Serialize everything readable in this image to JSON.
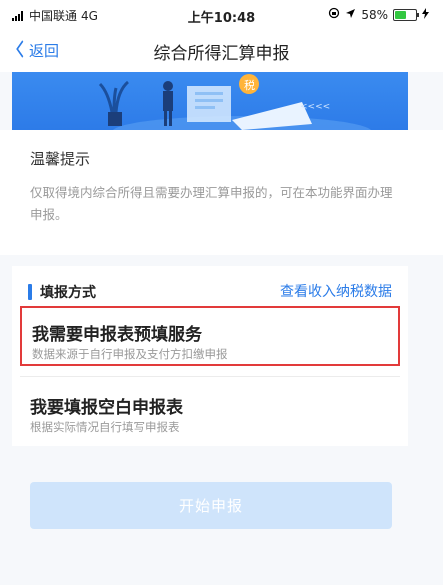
{
  "status_bar": {
    "carrier": "中国联通",
    "network": "4G",
    "time": "上午10:48",
    "battery": "58%",
    "battery_level": 0.58
  },
  "nav": {
    "back_label": "返回",
    "title": "综合所得汇算申报"
  },
  "banner": {
    "stamp_text": "税",
    "arrows": "<<<<"
  },
  "notice": {
    "title": "温馨提示",
    "text": "仅取得境内综合所得且需要办理汇算申报的，可在本功能界面办理申报。"
  },
  "fill_method": {
    "label": "填报方式",
    "link_label": "查看收入纳税数据",
    "options": [
      {
        "title": "我需要申报表预填服务",
        "subtitle": "数据来源于自行申报及支付方扣缴申报"
      },
      {
        "title": "我要填报空白申报表",
        "subtitle": "根据实际情况自行填写申报表"
      }
    ]
  },
  "start_button_label": "开始申报",
  "colors": {
    "accent": "#2b7ce8",
    "highlight_border": "#e23a3a",
    "disabled_button": "#cfe4fb"
  }
}
